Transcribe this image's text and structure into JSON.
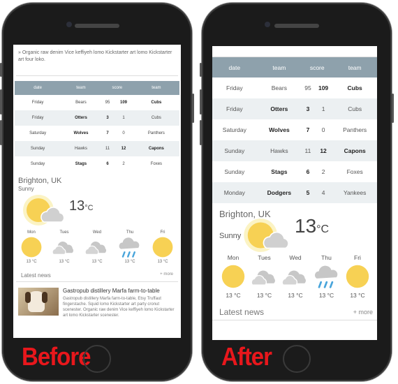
{
  "captions": {
    "before": "Before",
    "after": "After"
  },
  "article": {
    "intro": "» Organic raw denim Vice keffiyeh lomo Kickstarter art lomo Kickstarter art four loko."
  },
  "table": {
    "headers": [
      "date",
      "team",
      "score",
      "team"
    ],
    "rows": [
      {
        "date": "Friday",
        "home": "Bears",
        "home_score": "95",
        "away_score": "109",
        "away": "Cubs",
        "winner": "away"
      },
      {
        "date": "Friday",
        "home": "Otters",
        "home_score": "3",
        "away_score": "1",
        "away": "Cubs",
        "winner": "home"
      },
      {
        "date": "Saturday",
        "home": "Wolves",
        "home_score": "7",
        "away_score": "0",
        "away": "Panthers",
        "winner": "home"
      },
      {
        "date": "Sunday",
        "home": "Hawks",
        "home_score": "11",
        "away_score": "12",
        "away": "Capons",
        "winner": "away"
      },
      {
        "date": "Sunday",
        "home": "Stags",
        "home_score": "6",
        "away_score": "2",
        "away": "Foxes",
        "winner": "home"
      },
      {
        "date": "Monday",
        "home": "Dodgers",
        "home_score": "5",
        "away_score": "4",
        "away": "Yankees",
        "winner": "home"
      }
    ]
  },
  "weather": {
    "city": "Brighton, UK",
    "condition": "Sunny",
    "temp": "13",
    "unit": "°C",
    "days": [
      {
        "label": "Mon",
        "icon": "sun-icon",
        "temp": "13 °C"
      },
      {
        "label": "Tues",
        "icon": "cloud-icon",
        "temp": "13 °C"
      },
      {
        "label": "Wed",
        "icon": "cloud-icon",
        "temp": "13 °C"
      },
      {
        "label": "Thu",
        "icon": "rain-icon",
        "temp": "13 °C"
      },
      {
        "label": "Fri",
        "icon": "sun-icon",
        "temp": "13 °C"
      }
    ]
  },
  "news": {
    "heading": "Latest news",
    "more": "+ more",
    "item": {
      "title": "Gastropub distillery Marfa farm-to-table",
      "body": "Gastropub distillery Marfa farm-to-table, Etsy Truffaut fingerstache. Squid lomo Kickstarter art party cronut scenester. Organic raw denim Vice keffiyeh lomo Kickstarter art lomo Kickstarter scenester."
    }
  },
  "colors": {
    "header": "#8ea1ac",
    "stripe": "#ecf0f2",
    "sun": "#f7d154",
    "cloud": "#c7c7c7",
    "rain": "#49a5db",
    "caption": "#e8171c"
  }
}
